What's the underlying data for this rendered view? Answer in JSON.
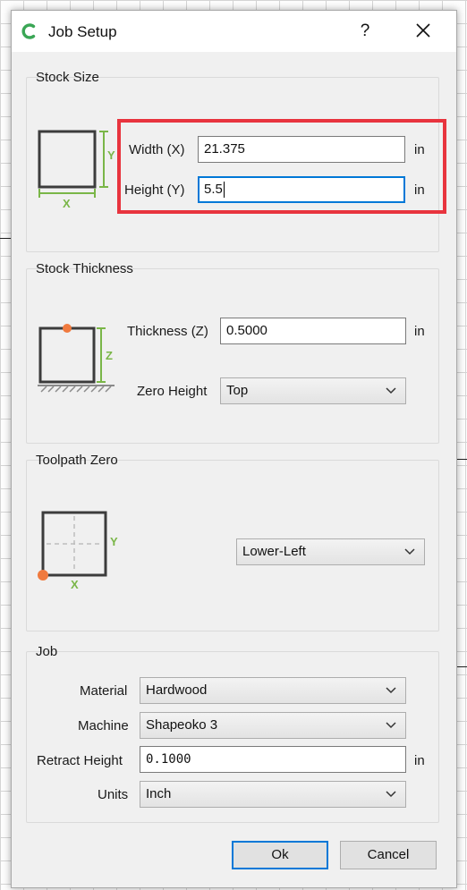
{
  "window": {
    "title": "Job Setup",
    "help_label": "?"
  },
  "stock_size": {
    "title": "Stock Size",
    "width_label": "Width (X)",
    "width_value": "21.375",
    "width_unit": "in",
    "height_label": "Height (Y)",
    "height_value": "5.5",
    "height_unit": "in",
    "diagram_y": "Y",
    "diagram_x": "X"
  },
  "stock_thickness": {
    "title": "Stock Thickness",
    "thickness_label": "Thickness (Z)",
    "thickness_value": "0.5000",
    "thickness_unit": "in",
    "zero_height_label": "Zero Height",
    "zero_height_value": "Top",
    "diagram_z": "Z"
  },
  "toolpath_zero": {
    "title": "Toolpath Zero",
    "position_value": "Lower-Left",
    "diagram_y": "Y",
    "diagram_x": "X"
  },
  "job": {
    "title": "Job",
    "material_label": "Material",
    "material_value": "Hardwood",
    "machine_label": "Machine",
    "machine_value": "Shapeoko 3",
    "retract_label": "Retract Height",
    "retract_value": "0.1000",
    "retract_unit": "in",
    "units_label": "Units",
    "units_value": "Inch"
  },
  "buttons": {
    "ok": "Ok",
    "cancel": "Cancel"
  },
  "colors": {
    "accent_green": "#7ab648",
    "point_orange": "#f07a3e",
    "highlight_red": "#e8343e",
    "focus_blue": "#0078d7"
  }
}
